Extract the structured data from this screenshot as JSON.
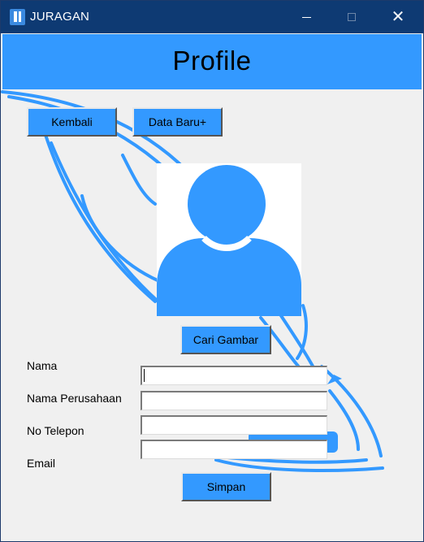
{
  "window": {
    "title": "JURAGAN",
    "controls": {
      "minimize": "─",
      "maximize": "□",
      "close": "✕"
    }
  },
  "header": {
    "title": "Profile"
  },
  "nav": {
    "back_label": "Kembali",
    "new_label": "Data Baru+"
  },
  "avatar": {
    "icon": "user-avatar-icon",
    "browse_label": "Cari Gambar"
  },
  "form": {
    "nama_label": "Nama",
    "nama_value": "",
    "perusahaan_label": "Nama Perusahaan",
    "perusahaan_value": "",
    "telepon_label": "No Telepon",
    "telepon_value": "",
    "email_label": "Email",
    "email_value": "",
    "save_label": "Simpan"
  },
  "colors": {
    "titlebar": "#0e3a73",
    "accent": "#3399ff",
    "background": "#f0f0f0"
  }
}
